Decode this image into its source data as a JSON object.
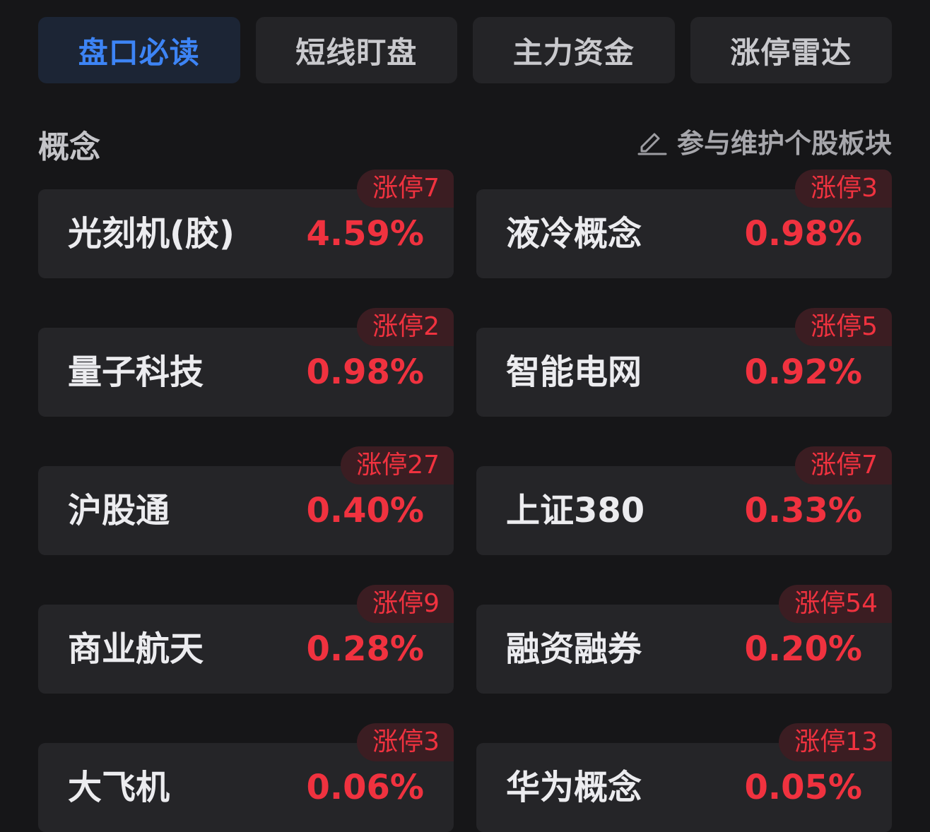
{
  "tabs": [
    {
      "label": "盘口必读",
      "active": true
    },
    {
      "label": "短线盯盘",
      "active": false
    },
    {
      "label": "主力资金",
      "active": false
    },
    {
      "label": "涨停雷达",
      "active": false
    }
  ],
  "section": {
    "title": "概念",
    "maintain_label": "参与维护个股板块",
    "maintain_icon": "edit-pencil-icon"
  },
  "concepts": [
    {
      "name": "光刻机(胶)",
      "change": "4.59%",
      "badge": "涨停7"
    },
    {
      "name": "液冷概念",
      "change": "0.98%",
      "badge": "涨停3"
    },
    {
      "name": "量子科技",
      "change": "0.98%",
      "badge": "涨停2"
    },
    {
      "name": "智能电网",
      "change": "0.92%",
      "badge": "涨停5"
    },
    {
      "name": "沪股通",
      "change": "0.40%",
      "badge": "涨停27"
    },
    {
      "name": "上证380",
      "change": "0.33%",
      "badge": "涨停7"
    },
    {
      "name": "商业航天",
      "change": "0.28%",
      "badge": "涨停9"
    },
    {
      "name": "融资融券",
      "change": "0.20%",
      "badge": "涨停54"
    },
    {
      "name": "大飞机",
      "change": "0.06%",
      "badge": "涨停3"
    },
    {
      "name": "华为概念",
      "change": "0.05%",
      "badge": "涨停13"
    }
  ],
  "colors": {
    "background": "#161618",
    "card": "#252528",
    "active_tab_text": "#3d84f5",
    "rise_red": "#f0323f",
    "badge_bg": "#3b1d22"
  }
}
